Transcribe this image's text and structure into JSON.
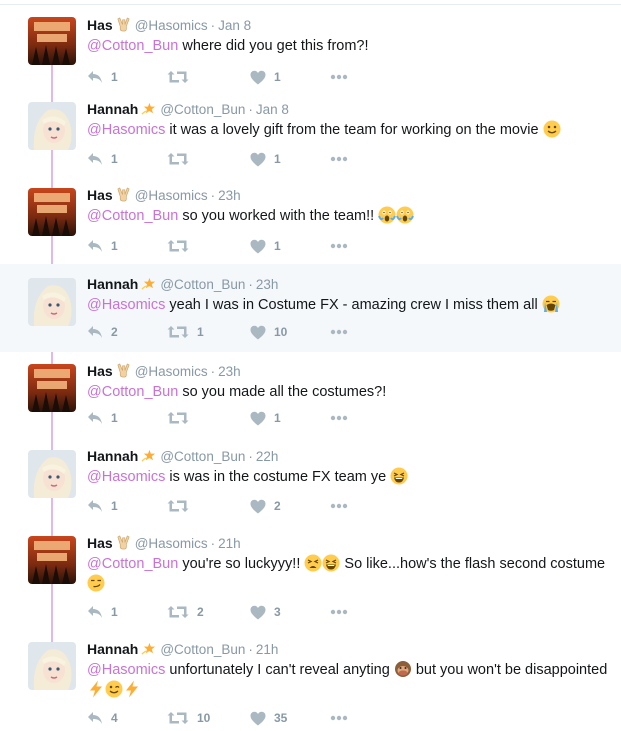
{
  "tweets": [
    {
      "name": "Has",
      "handle": "@Hasomics",
      "time": "Jan 8",
      "avatar": "justice-league",
      "badge": "victory-hand",
      "mention": "@Cotton_Bun",
      "text": " where did you get this from?!",
      "emojis": [],
      "text2": "",
      "emojis2": [],
      "replies": "1",
      "retweets": "",
      "likes": "1"
    },
    {
      "name": "Hannah",
      "handle": "@Cotton_Bun",
      "time": "Jan 8",
      "avatar": "hannah",
      "badge": "dizzy-star",
      "mention": "@Hasomics",
      "text": " it was a lovely gift from the team for working on the movie ",
      "emojis": [
        "slight-smile"
      ],
      "text2": "",
      "emojis2": [],
      "replies": "1",
      "retweets": "",
      "likes": "1"
    },
    {
      "name": "Has",
      "handle": "@Hasomics",
      "time": "23h",
      "avatar": "justice-league",
      "badge": "victory-hand",
      "mention": "@Cotton_Bun",
      "text": " so you worked with the team!! ",
      "emojis": [
        "scream",
        "scream"
      ],
      "text2": "",
      "emojis2": [],
      "replies": "1",
      "retweets": "",
      "likes": "1"
    },
    {
      "name": "Hannah",
      "handle": "@Cotton_Bun",
      "time": "23h",
      "avatar": "hannah",
      "badge": "dizzy-star",
      "mention": "@Hasomics",
      "text": " yeah I was in Costume FX - amazing crew I miss them all ",
      "emojis": [
        "loud-cry"
      ],
      "text2": "",
      "emojis2": [],
      "replies": "2",
      "retweets": "1",
      "likes": "10"
    },
    {
      "name": "Has",
      "handle": "@Hasomics",
      "time": "23h",
      "avatar": "justice-league",
      "badge": "victory-hand",
      "mention": "@Cotton_Bun",
      "text": " so you made all the costumes?!",
      "emojis": [],
      "text2": "",
      "emojis2": [],
      "replies": "1",
      "retweets": "",
      "likes": "1"
    },
    {
      "name": "Hannah",
      "handle": "@Cotton_Bun",
      "time": "22h",
      "avatar": "hannah",
      "badge": "dizzy-star",
      "mention": "@Hasomics",
      "text": " is was in the costume FX team ye ",
      "emojis": [
        "laughing"
      ],
      "text2": "",
      "emojis2": [],
      "replies": "1",
      "retweets": "",
      "likes": "2"
    },
    {
      "name": "Has",
      "handle": "@Hasomics",
      "time": "21h",
      "avatar": "justice-league",
      "badge": "victory-hand",
      "mention": "@Cotton_Bun",
      "text": " you're so luckyyy!! ",
      "emojis": [
        "tired",
        "laughing"
      ],
      "text2": " So like...how's the flash second costume ",
      "emojis2": [
        "smirk"
      ],
      "replies": "1",
      "retweets": "2",
      "likes": "3"
    },
    {
      "name": "Hannah",
      "handle": "@Cotton_Bun",
      "time": "21h",
      "avatar": "hannah",
      "badge": "dizzy-star",
      "mention": "@Hasomics",
      "text": " unfortunately I can't reveal anyting ",
      "emojis": [
        "speak-no-evil-monkey"
      ],
      "text2": " but you won't be disappointed ",
      "emojis2": [
        "zap",
        "wink",
        "zap"
      ],
      "replies": "4",
      "retweets": "10",
      "likes": "35"
    }
  ],
  "colors": {
    "mention": "#c873d8",
    "thread_line": "#e1b8ec",
    "meta": "#8899a6",
    "highlight": "#f5f8fa"
  }
}
